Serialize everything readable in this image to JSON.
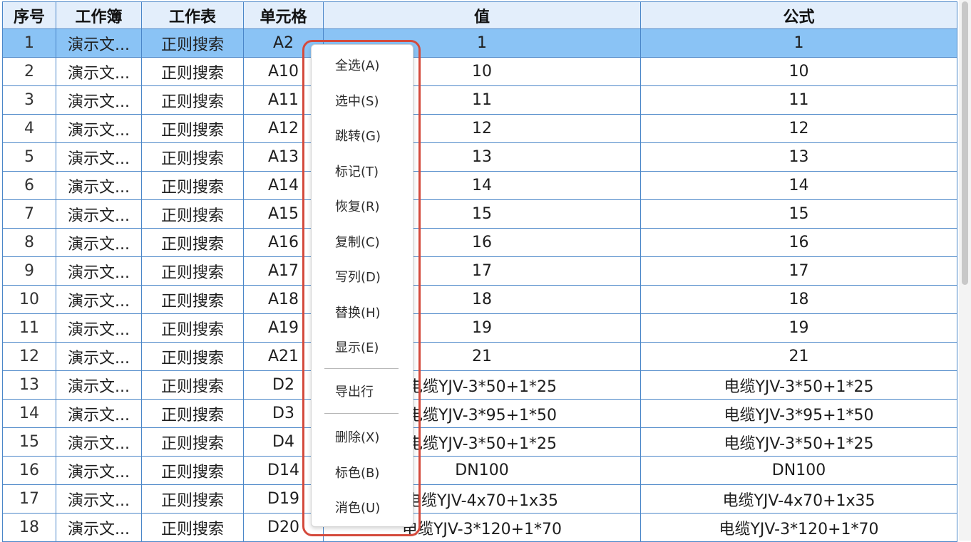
{
  "table": {
    "headers": {
      "index": "序号",
      "workbook": "工作簿",
      "worksheet": "工作表",
      "cell": "单元格",
      "value": "值",
      "formula": "公式"
    },
    "rows": [
      {
        "index": "1",
        "workbook": "演示文...",
        "worksheet": "正则搜索",
        "cell": "A2",
        "value": "1",
        "formula": "1"
      },
      {
        "index": "2",
        "workbook": "演示文...",
        "worksheet": "正则搜索",
        "cell": "A10",
        "value": "10",
        "formula": "10"
      },
      {
        "index": "3",
        "workbook": "演示文...",
        "worksheet": "正则搜索",
        "cell": "A11",
        "value": "11",
        "formula": "11"
      },
      {
        "index": "4",
        "workbook": "演示文...",
        "worksheet": "正则搜索",
        "cell": "A12",
        "value": "12",
        "formula": "12"
      },
      {
        "index": "5",
        "workbook": "演示文...",
        "worksheet": "正则搜索",
        "cell": "A13",
        "value": "13",
        "formula": "13"
      },
      {
        "index": "6",
        "workbook": "演示文...",
        "worksheet": "正则搜索",
        "cell": "A14",
        "value": "14",
        "formula": "14"
      },
      {
        "index": "7",
        "workbook": "演示文...",
        "worksheet": "正则搜索",
        "cell": "A15",
        "value": "15",
        "formula": "15"
      },
      {
        "index": "8",
        "workbook": "演示文...",
        "worksheet": "正则搜索",
        "cell": "A16",
        "value": "16",
        "formula": "16"
      },
      {
        "index": "9",
        "workbook": "演示文...",
        "worksheet": "正则搜索",
        "cell": "A17",
        "value": "17",
        "formula": "17"
      },
      {
        "index": "10",
        "workbook": "演示文...",
        "worksheet": "正则搜索",
        "cell": "A18",
        "value": "18",
        "formula": "18"
      },
      {
        "index": "11",
        "workbook": "演示文...",
        "worksheet": "正则搜索",
        "cell": "A19",
        "value": "19",
        "formula": "19"
      },
      {
        "index": "12",
        "workbook": "演示文...",
        "worksheet": "正则搜索",
        "cell": "A21",
        "value": "21",
        "formula": "21"
      },
      {
        "index": "13",
        "workbook": "演示文...",
        "worksheet": "正则搜索",
        "cell": "D2",
        "value": "电缆YJV-3*50+1*25",
        "formula": "电缆YJV-3*50+1*25"
      },
      {
        "index": "14",
        "workbook": "演示文...",
        "worksheet": "正则搜索",
        "cell": "D3",
        "value": "电缆YJV-3*95+1*50",
        "formula": "电缆YJV-3*95+1*50"
      },
      {
        "index": "15",
        "workbook": "演示文...",
        "worksheet": "正则搜索",
        "cell": "D4",
        "value": "电缆YJV-3*50+1*25",
        "formula": "电缆YJV-3*50+1*25"
      },
      {
        "index": "16",
        "workbook": "演示文...",
        "worksheet": "正则搜索",
        "cell": "D14",
        "value": "DN100",
        "formula": "DN100"
      },
      {
        "index": "17",
        "workbook": "演示文...",
        "worksheet": "正则搜索",
        "cell": "D19",
        "value": "电缆YJV-4x70+1x35",
        "formula": "电缆YJV-4x70+1x35"
      },
      {
        "index": "18",
        "workbook": "演示文...",
        "worksheet": "正则搜索",
        "cell": "D20",
        "value": "电缆YJV-3*120+1*70",
        "formula": "电缆YJV-3*120+1*70"
      }
    ],
    "selected_row": "1"
  },
  "context_menu": {
    "items": [
      {
        "label": "全选(A)"
      },
      {
        "label": "选中(S)"
      },
      {
        "label": "跳转(G)"
      },
      {
        "label": "标记(T)"
      },
      {
        "label": "恢复(R)"
      },
      {
        "label": "复制(C)"
      },
      {
        "label": "写列(D)"
      },
      {
        "label": "替换(H)"
      },
      {
        "label": "显示(E)"
      },
      {
        "label": "导出行"
      },
      {
        "label": "删除(X)"
      },
      {
        "label": "标色(B)"
      },
      {
        "label": "消色(U)"
      }
    ]
  },
  "colors": {
    "grid_border": "#4a86c8",
    "header_bg": "#e3eefb",
    "selected_row_bg": "#8ac3f5",
    "highlight_outline": "#d44a3c"
  }
}
